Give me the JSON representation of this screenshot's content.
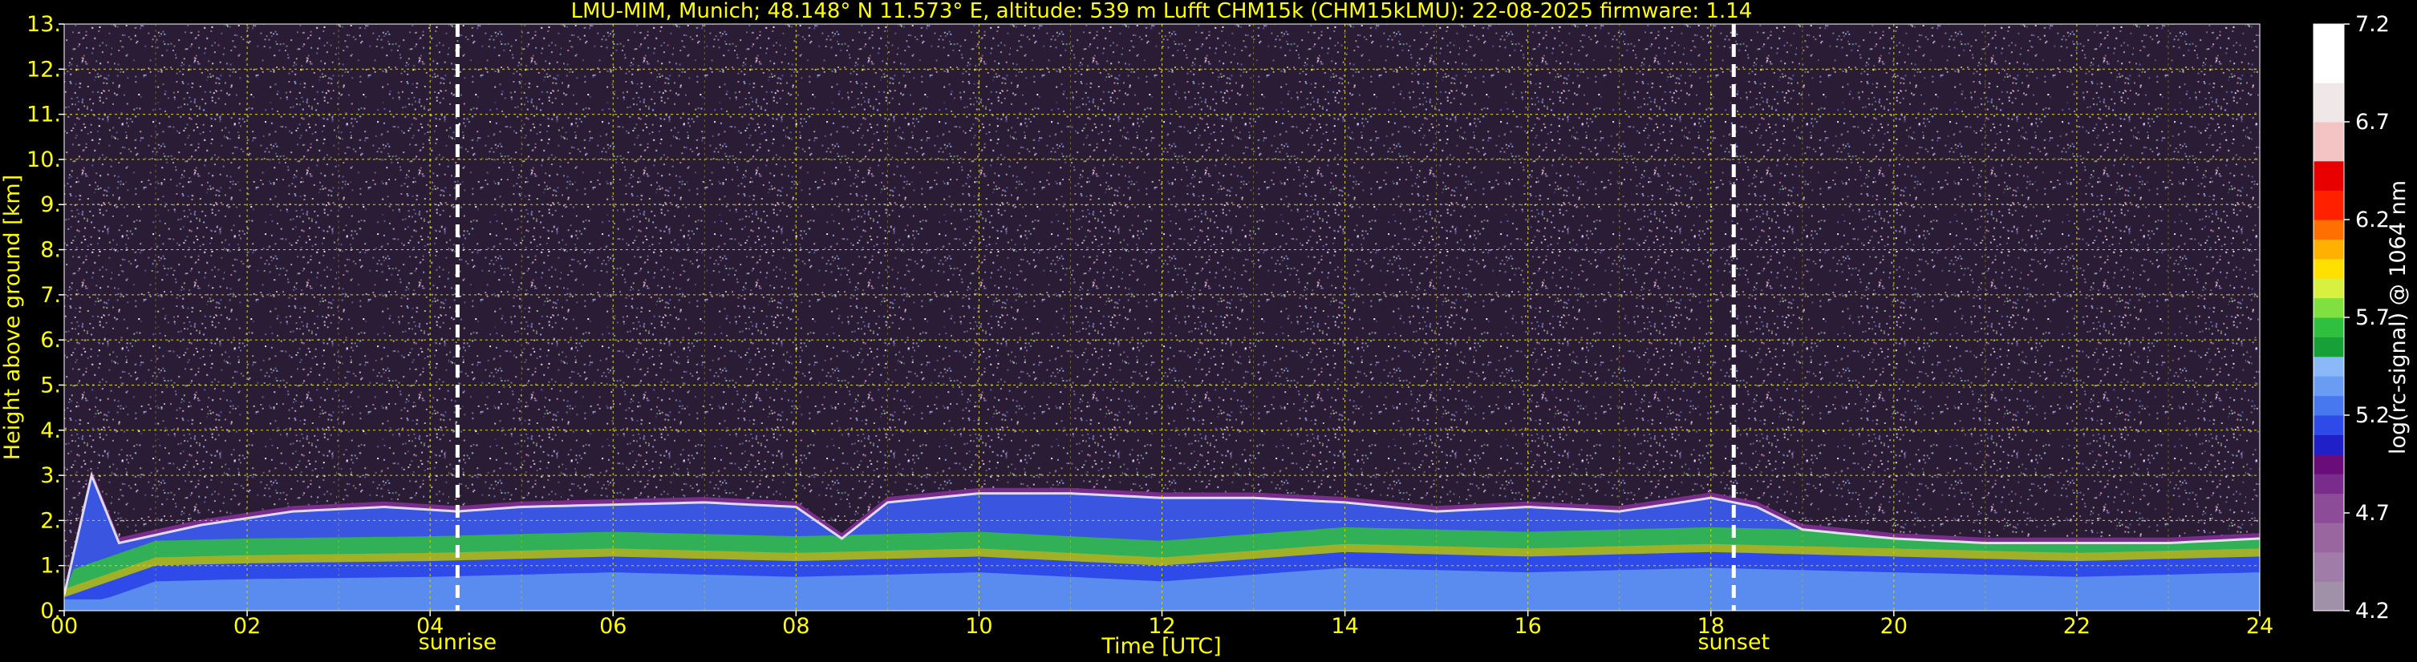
{
  "header": {
    "title": "LMU-MIM, Munich; 48.148° N 11.573° E, altitude: 539 m    Lufft CHM15k (CHM15kLMU): 22-08-2025    firmware: 1.14"
  },
  "colors": {
    "text": "#ffff00",
    "grid": "#d8d800",
    "background": "#000000",
    "sun_lines": "#ffffff",
    "colorbar_text": "#ffffff"
  },
  "chart_data": {
    "type": "heatmap",
    "title": "LMU-MIM, Munich; 48.148° N 11.573° E, altitude: 539 m    Lufft CHM15k (CHM15kLMU): 22-08-2025    firmware: 1.14",
    "xlabel": "Time [UTC]",
    "ylabel": "Height above ground [km]",
    "xlim": [
      0,
      24
    ],
    "ylim": [
      0,
      13
    ],
    "x_ticks": [
      0,
      2,
      4,
      6,
      8,
      10,
      12,
      14,
      16,
      18,
      20,
      22,
      24
    ],
    "x_tick_labels": [
      "00",
      "02",
      "04",
      "06",
      "08",
      "10",
      "12",
      "14",
      "16",
      "18",
      "20",
      "22",
      "24"
    ],
    "y_ticks": [
      0,
      1,
      2,
      3,
      4,
      5,
      6,
      7,
      8,
      9,
      10,
      11,
      12,
      13
    ],
    "y_tick_labels": [
      "0.",
      "1.",
      "2.",
      "3.",
      "4.",
      "5.",
      "6.",
      "7.",
      "8.",
      "9.",
      "10.",
      "11.",
      "12.",
      "13."
    ],
    "grid": true,
    "annotations": [
      {
        "label": "sunrise",
        "x": 4.3
      },
      {
        "label": "sunset",
        "x": 18.25
      }
    ],
    "colorbar": {
      "label": "log(rc-signal) @ 1064 nm",
      "range": [
        4.2,
        7.2
      ],
      "ticks": [
        4.2,
        4.7,
        5.2,
        5.7,
        6.2,
        6.7,
        7.2
      ],
      "tick_labels": [
        "4.2",
        "4.7",
        "5.2",
        "5.7",
        "6.2",
        "6.7",
        "7.2"
      ],
      "levels": [
        {
          "from": 4.2,
          "color": "#a090a8"
        },
        {
          "from": 4.35,
          "color": "#a07ca8"
        },
        {
          "from": 4.5,
          "color": "#9a66a0"
        },
        {
          "from": 4.65,
          "color": "#8c4c98"
        },
        {
          "from": 4.8,
          "color": "#7a2c8c"
        },
        {
          "from": 4.9,
          "color": "#6a0c7a"
        },
        {
          "from": 5.0,
          "color": "#2020c8"
        },
        {
          "from": 5.1,
          "color": "#2e4ae8"
        },
        {
          "from": 5.2,
          "color": "#4878f0"
        },
        {
          "from": 5.3,
          "color": "#6a9cf4"
        },
        {
          "from": 5.4,
          "color": "#8ab8f8"
        },
        {
          "from": 5.5,
          "color": "#18a038"
        },
        {
          "from": 5.6,
          "color": "#30c040"
        },
        {
          "from": 5.7,
          "color": "#80e040"
        },
        {
          "from": 5.8,
          "color": "#d8f040"
        },
        {
          "from": 5.9,
          "color": "#ffe000"
        },
        {
          "from": 6.0,
          "color": "#ffb000"
        },
        {
          "from": 6.1,
          "color": "#ff7000"
        },
        {
          "from": 6.2,
          "color": "#ff2000"
        },
        {
          "from": 6.35,
          "color": "#e80000"
        },
        {
          "from": 6.5,
          "color": "#f4c4c4"
        },
        {
          "from": 6.7,
          "color": "#f0e8e8"
        },
        {
          "from": 6.9,
          "color": "#ffffff"
        }
      ]
    },
    "boundary_layer": {
      "description_units": "height in km vs time in hours",
      "top_height": [
        [
          0.0,
          0.35
        ],
        [
          0.3,
          3.0
        ],
        [
          0.6,
          1.5
        ],
        [
          1.5,
          1.9
        ],
        [
          2.5,
          2.2
        ],
        [
          3.5,
          2.3
        ],
        [
          4.3,
          2.2
        ],
        [
          5.0,
          2.3
        ],
        [
          6.0,
          2.35
        ],
        [
          7.0,
          2.4
        ],
        [
          8.0,
          2.3
        ],
        [
          8.5,
          1.6
        ],
        [
          9.0,
          2.4
        ],
        [
          10.0,
          2.6
        ],
        [
          11.0,
          2.6
        ],
        [
          12.0,
          2.5
        ],
        [
          13.0,
          2.5
        ],
        [
          14.0,
          2.4
        ],
        [
          15.0,
          2.2
        ],
        [
          16.0,
          2.3
        ],
        [
          17.0,
          2.2
        ],
        [
          18.0,
          2.5
        ],
        [
          18.5,
          2.3
        ],
        [
          19.0,
          1.8
        ],
        [
          20.0,
          1.6
        ],
        [
          21.0,
          1.5
        ],
        [
          22.0,
          1.5
        ],
        [
          23.0,
          1.5
        ],
        [
          24.0,
          1.6
        ]
      ],
      "layer_height": [
        [
          0.0,
          0.3
        ],
        [
          1.0,
          1.0
        ],
        [
          2.0,
          1.05
        ],
        [
          4.0,
          1.1
        ],
        [
          6.0,
          1.2
        ],
        [
          8.0,
          1.1
        ],
        [
          10.0,
          1.2
        ],
        [
          12.0,
          1.0
        ],
        [
          14.0,
          1.3
        ],
        [
          16.0,
          1.2
        ],
        [
          18.0,
          1.3
        ],
        [
          20.0,
          1.2
        ],
        [
          22.0,
          1.1
        ],
        [
          24.0,
          1.2
        ]
      ]
    }
  }
}
